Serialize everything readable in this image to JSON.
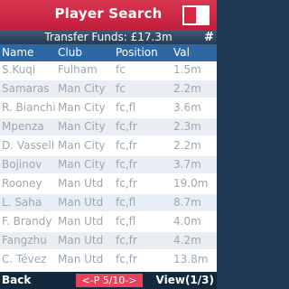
{
  "header": {
    "title": "Player Search"
  },
  "funds": {
    "text": "Transfer Funds: £17.3m"
  },
  "table": {
    "columns": [
      "Name",
      "Club",
      "Position",
      "Val"
    ],
    "rows": [
      [
        "S.Kuqi",
        "Fulham",
        "fc",
        "1.5m"
      ],
      [
        "Samaras",
        "Man City",
        "fc",
        "2.2m"
      ],
      [
        "R. Bianchi",
        "Man City",
        "fc,fl",
        "3.6m"
      ],
      [
        "Mpenza",
        "Man City",
        "fc,fr",
        "2.3m"
      ],
      [
        "D. Vassell",
        "Man City",
        "fc,fr",
        "2.2m"
      ],
      [
        "Bojinov",
        "Man City",
        "fc,fr",
        "3.7m"
      ],
      [
        "Rooney",
        "Man Utd",
        "fc,fr",
        "19.0m"
      ],
      [
        "L. Saha",
        "Man Utd",
        "fc,fl",
        "8.7m"
      ],
      [
        "F. Brandy",
        "Man Utd",
        "fc,fl",
        "4.0m"
      ],
      [
        "Fangzhu",
        "Man Utd",
        "fc,fr",
        "4.2m"
      ],
      [
        "C. Tévez",
        "Man Utd",
        "fc,fr",
        "13.8m"
      ]
    ]
  },
  "softkeys": {
    "left": "Back",
    "center": "<-P 5/10->",
    "right": "View(1/3)"
  },
  "icons": {
    "flag": "flag-icon",
    "menu": "hash-icon"
  },
  "colors": {
    "header": "#c8223f",
    "table_header": "#2f67a3",
    "page_indicator": "#e8425a"
  }
}
